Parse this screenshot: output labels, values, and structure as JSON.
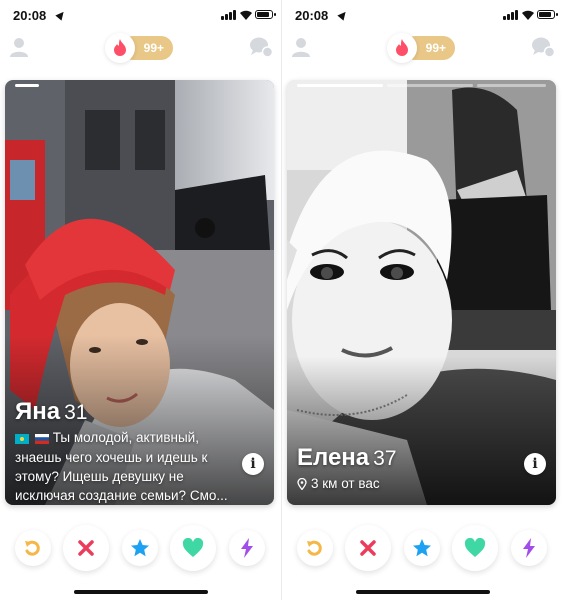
{
  "status_bar": {
    "time": "20:08"
  },
  "header": {
    "likes_count": "99+"
  },
  "colors": {
    "accent": "#fd5068",
    "gold": "#e8c787",
    "rewind": "#f5b748",
    "nope": "#ec3c5c",
    "superlike": "#1da1f2",
    "like": "#3fd8a4",
    "boost": "#a24dea"
  },
  "icons": {
    "profile": "person-icon",
    "flame": "flame-icon",
    "chat": "chat-bubbles-icon",
    "info": "info-icon",
    "location": "location-pin-icon"
  },
  "cards": [
    {
      "name": "Яна",
      "age": "31",
      "bio": "Ты молодой, активный, знаешь чего хочешь и идешь к этому? Ищешь девушку не исключая создание семьи? Смо...",
      "flags": [
        "kazakhstan-flag",
        "russia-flag"
      ]
    },
    {
      "name": "Елена",
      "age": "37",
      "distance": "3 км от вас"
    }
  ],
  "actions": [
    "rewind",
    "nope",
    "super-like",
    "like",
    "boost"
  ]
}
